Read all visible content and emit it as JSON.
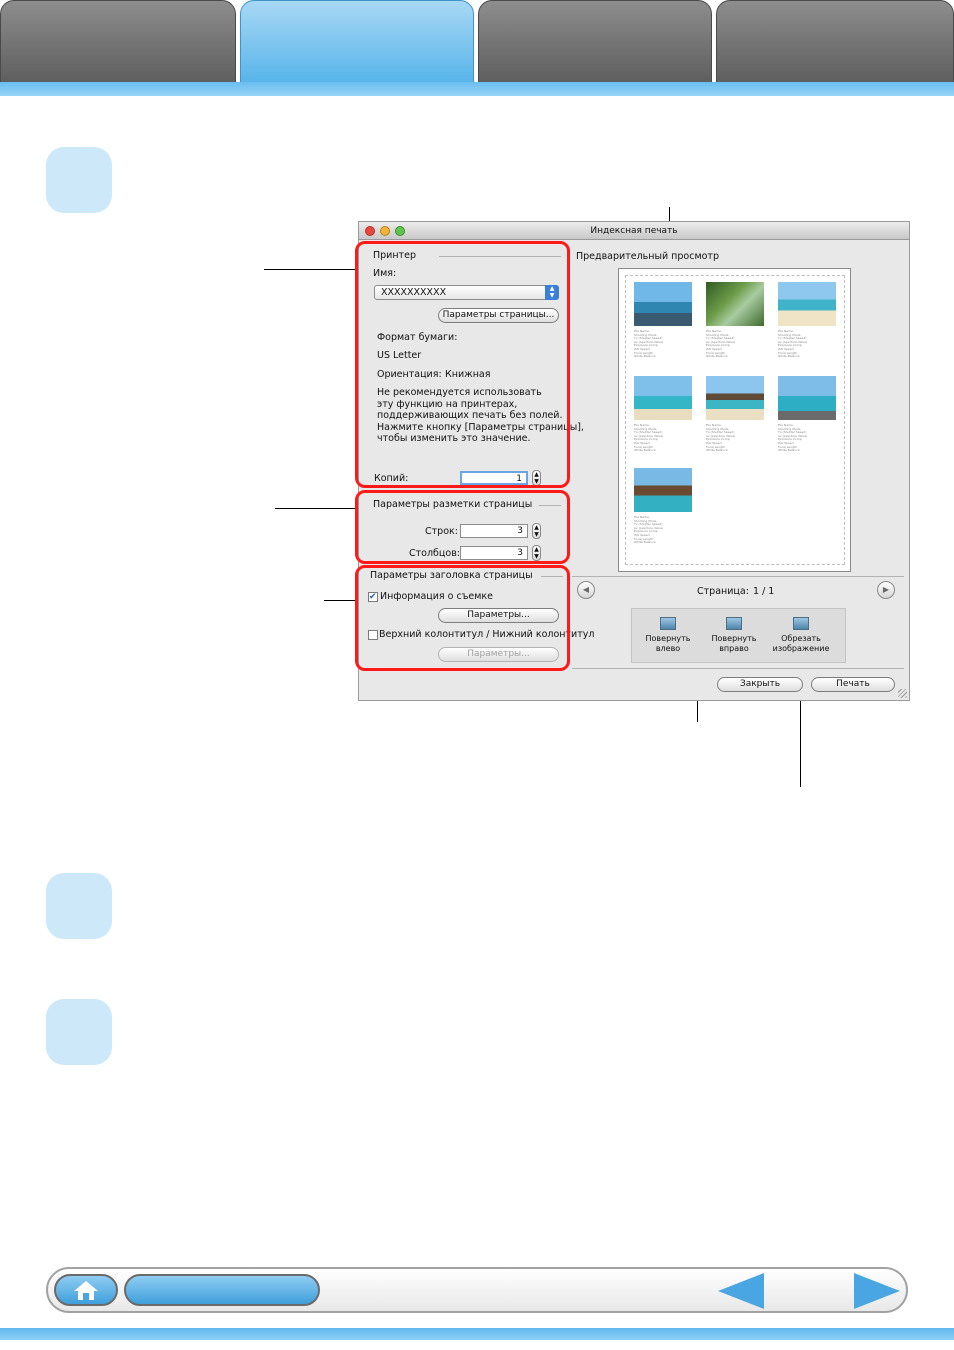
{
  "dialog": {
    "title": "Индексная печать",
    "printer_section": "Принтер",
    "name_label": "Имя:",
    "printer_name": "XXXXXXXXXX",
    "page_setup_button": "Параметры страницы...",
    "paper_format_label": "Формат бумаги:",
    "paper_format_value": "US Letter",
    "orientation_label": "Ориентация:",
    "orientation_value": "Книжная",
    "warning_lines": [
      "Не рекомендуется использовать",
      "эту функцию на принтерах,",
      "поддерживающих печать без полей.",
      "Нажмите кнопку [Параметры страницы],",
      "чтобы изменить это значение."
    ],
    "copies_label": "Копий:",
    "copies_value": "1",
    "layout_section": "Параметры разметки страницы",
    "rows_label": "Строк:",
    "rows_value": "3",
    "cols_label": "Столбцов:",
    "cols_value": "3",
    "header_section": "Параметры заголовка страницы",
    "shooting_info_label": "Информация о съемке",
    "shooting_info_checked": true,
    "params_button": "Параметры...",
    "header_footer_label": "Верхний колонтитул / Нижний колонтитул",
    "header_footer_checked": false,
    "params_button_disabled": "Параметры...",
    "preview_label": "Предварительный просмотр",
    "page_label": "Страница:",
    "page_value": "1 / 1",
    "rotate_left": [
      "Повернуть",
      "влево"
    ],
    "rotate_right": [
      "Повернуть",
      "вправо"
    ],
    "crop": [
      "Обрезать",
      "изображение"
    ],
    "close_button": "Закрыть",
    "print_button": "Печать"
  },
  "icons": [
    "home-icon",
    "prev-arrow-icon",
    "next-arrow-icon",
    "rotate-left-icon",
    "rotate-right-icon",
    "crop-icon"
  ],
  "colors": {
    "accent": "#55b3ea",
    "highlight": "#ff1a1a",
    "step": "#cde8f8"
  }
}
